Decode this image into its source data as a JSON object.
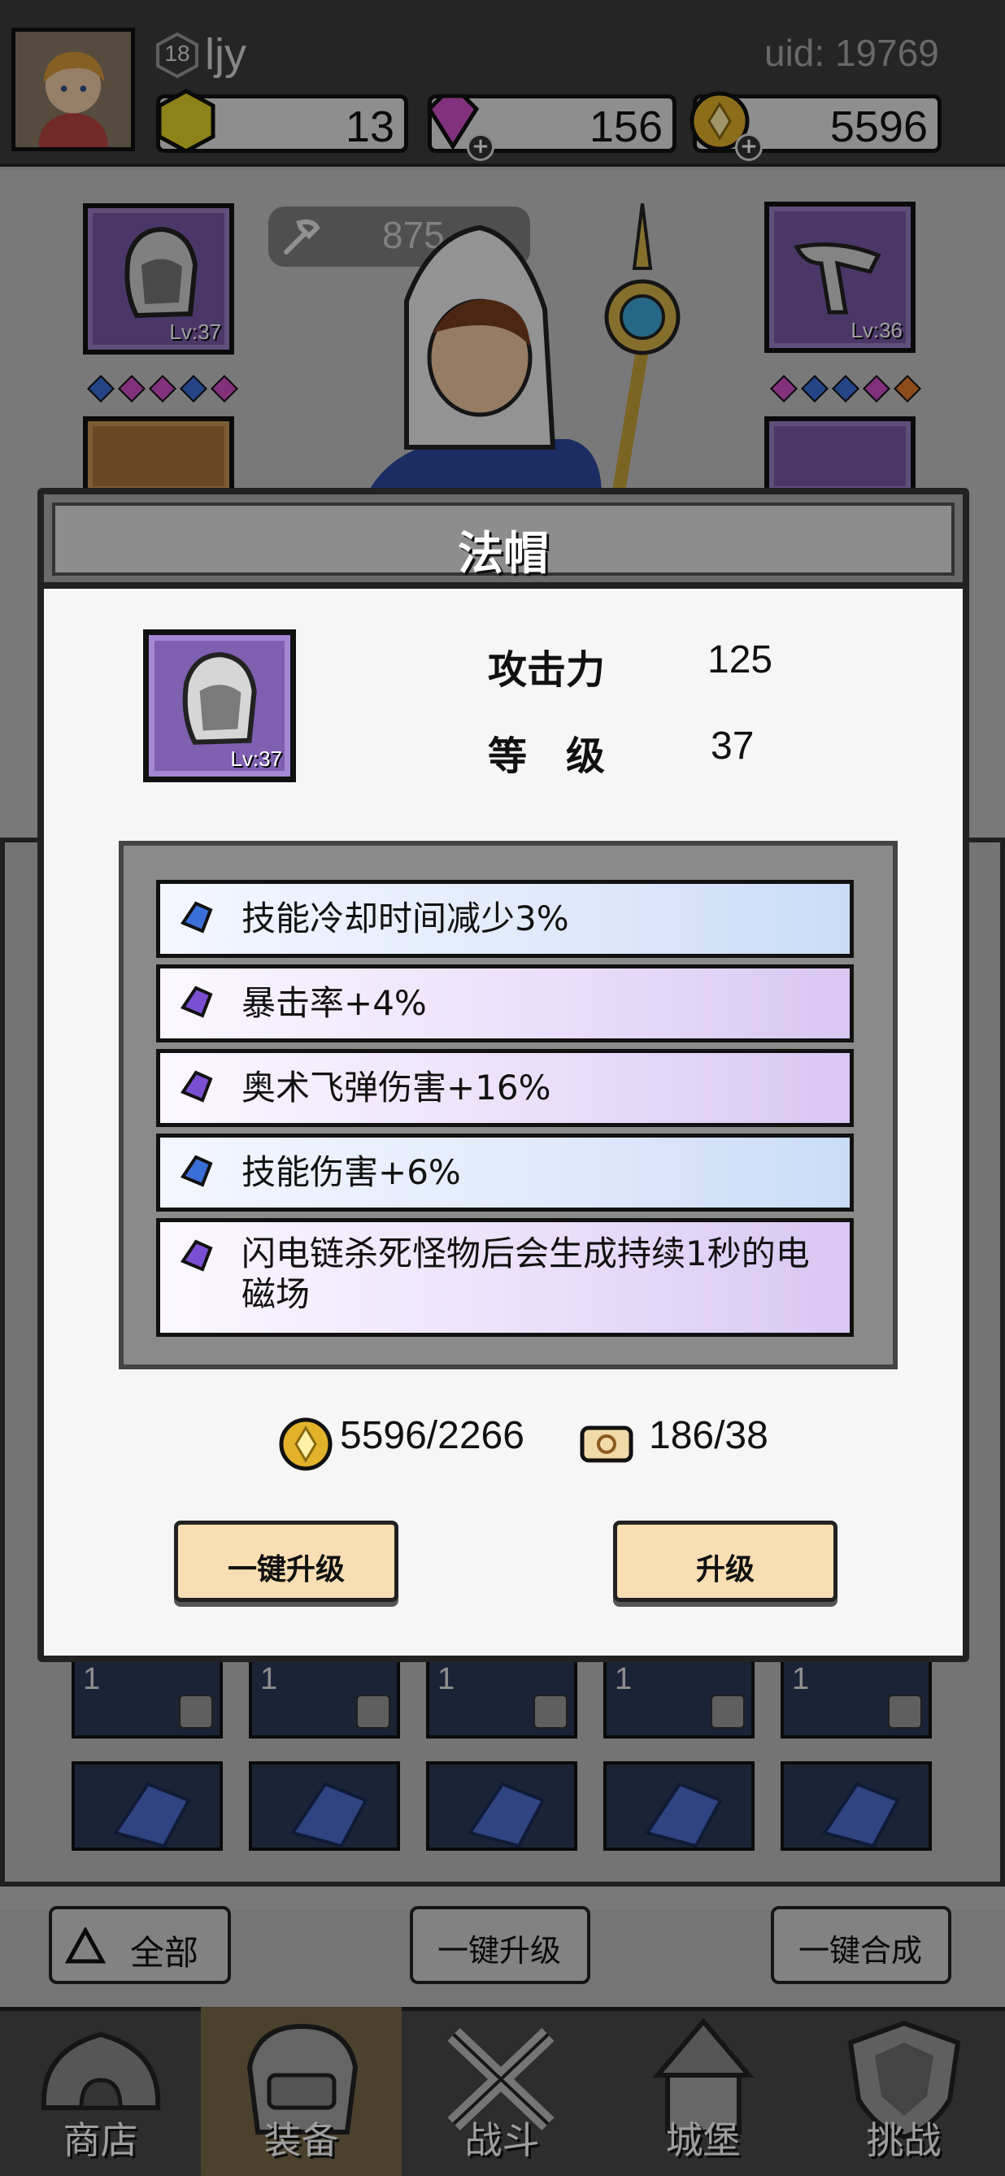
{
  "player": {
    "name": "ljy",
    "level": "18",
    "uid": "uid: 19769"
  },
  "resources": {
    "energy": "13",
    "gems": "156",
    "gold": "5596"
  },
  "hero": {
    "power": "875"
  },
  "equipment": {
    "left_top_lv": "Lv:37",
    "right_top_lv": "Lv:36"
  },
  "inventory": {
    "count": "1"
  },
  "filters": {
    "all": "全部",
    "upgrade_all": "一键升级",
    "merge_all": "一键合成"
  },
  "nav": {
    "shop": "商店",
    "equip": "装备",
    "battle": "战斗",
    "castle": "城堡",
    "challenge": "挑战"
  },
  "dialog": {
    "title": "法帽",
    "item_level": "Lv:37",
    "stats": [
      {
        "label": "攻击力",
        "value": "125"
      },
      {
        "label": "等　级",
        "value": "37"
      }
    ],
    "affixes": [
      {
        "text": "技能冷却时间减少3%",
        "color": "blue"
      },
      {
        "text": "暴击率+4%",
        "color": "purple"
      },
      {
        "text": "奥术飞弹伤害+16%",
        "color": "purple"
      },
      {
        "text": "技能伤害+6%",
        "color": "blue"
      },
      {
        "text": "闪电链杀死怪物后会生成持续1秒的电磁场",
        "color": "purple"
      }
    ],
    "cost_gold": "5596/2266",
    "cost_scroll": "186/38",
    "btn_upgrade_all": "一键升级",
    "btn_upgrade": "升级"
  },
  "colors": {
    "gem_blue": "#3a6fd8",
    "gem_purple": "#7b4fd1",
    "button_bg": "#f8deb2",
    "epic_slot": "#7e5fb0"
  }
}
